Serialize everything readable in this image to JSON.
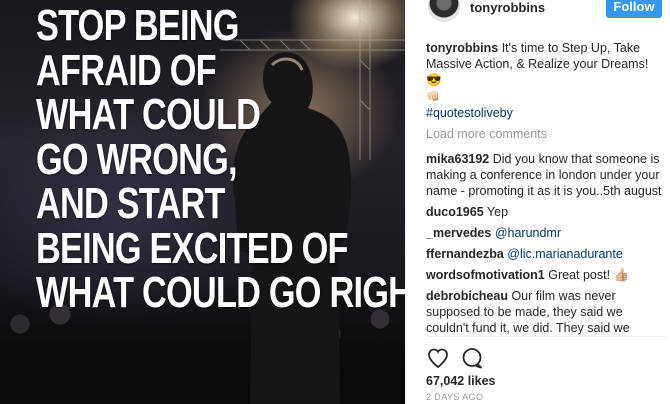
{
  "photo": {
    "quote_lines": [
      "STOP BEING",
      "AFRAID OF",
      "WHAT COULD",
      "GO WRONG,",
      "AND START",
      "BEING EXCITED OF",
      "WHAT COULD GO RIGHT."
    ]
  },
  "header": {
    "username": "tonyrobbins",
    "follow_label": "Follow"
  },
  "caption": {
    "username": "tonyrobbins",
    "text": "It's time to Step Up, Take Massive Action, & Realize your Dreams! 😎",
    "emoji_line": "👊🏻",
    "hashtag": "#quotestoliveby"
  },
  "load_more": "Load more comments",
  "comments": [
    {
      "username": "mika63192",
      "text": "Did you know that someone is making a conference in london under your name - promoting it as it is you..5th august"
    },
    {
      "username": "duco1965",
      "text": "Yep"
    },
    {
      "username": "_mervedes",
      "text": "@harundmr"
    },
    {
      "username": "ffernandezba",
      "text": "@lic.marianadurante"
    },
    {
      "username": "wordsofmotivation1",
      "text": "Great post! 👍🏼"
    },
    {
      "username": "debrobicheau",
      "text": "Our film was never supposed to be made, they said we couldn't fund it, we did. They said we couldn't shoot it in under 3 weeks, WE HAVE. They said we could never #Stop #bullying ... BUT we know we can make a difference. This is our journey"
    }
  ],
  "likes": "67,042 likes",
  "timestamp": "2 DAYS AGO",
  "icons": {
    "like": "heart-icon",
    "comment": "comment-bubble-icon"
  },
  "colors": {
    "follow_button": "#3897f0",
    "link": "#003569",
    "muted": "#999999"
  }
}
